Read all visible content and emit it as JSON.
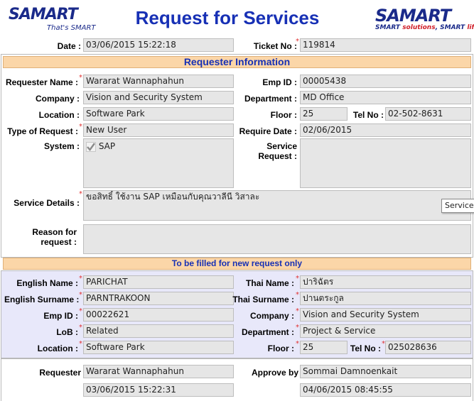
{
  "header": {
    "logo_left": "SAMART",
    "logo_left_tagline": "That's SMART",
    "title": "Request for Services",
    "logo_right": "SAMART",
    "logo_right_tagline_a": "SMART ",
    "logo_right_tagline_b": "solutions",
    "logo_right_tagline_c": ", SMART ",
    "logo_right_tagline_d": "life"
  },
  "top": {
    "date_label": "Date :",
    "date_value": "03/06/2015 15:22:18",
    "ticket_label": "Ticket No :",
    "ticket_value": "119814"
  },
  "requester_section": {
    "title": "Requester Information",
    "requester_name_label": "Requester Name :",
    "requester_name_value": "Wararat Wannaphahun",
    "emp_id_label": "Emp ID :",
    "emp_id_value": "00005438",
    "company_label": "Company :",
    "company_value": "Vision and Security System",
    "department_label": "Department :",
    "department_value": "MD Office",
    "location_label": "Location :",
    "location_value": "Software Park",
    "floor_label": "Floor :",
    "floor_value": "25",
    "tel_label": "Tel No :",
    "tel_value": "02-502-8631",
    "type_label": "Type of Request :",
    "type_value": "New User",
    "require_date_label": "Require Date :",
    "require_date_value": "02/06/2015",
    "system_label": "System :",
    "system_item": "SAP",
    "system_item_checked": true,
    "service_request_label_1": "Service",
    "service_request_label_2": "Request :",
    "service_request_value": "",
    "service_details_label": "Service Details :",
    "service_details_value": "ขอสิทธิ์ ใช้งาน SAP เหมือนกับคุณวาลีนี วิสาละ",
    "reason_label_1": "Reason for",
    "reason_label_2": "request :",
    "reason_value": "",
    "tooltip": "Service"
  },
  "new_request_section": {
    "title": "To be filled for new request only",
    "english_name_label": "English Name :",
    "english_name_value": "PARICHAT",
    "thai_name_label": "Thai Name :",
    "thai_name_value": "ปาริฉัตร",
    "english_surname_label": "English Surname :",
    "english_surname_value": "PARNTRAKOON",
    "thai_surname_label": "Thai Surname :",
    "thai_surname_value": "ปานตระกูล",
    "emp_id_label": "Emp ID :",
    "emp_id_value": "00022621",
    "company_label": "Company :",
    "company_value": "Vision and Security System",
    "lob_label": "LoB :",
    "lob_value": "Related",
    "department_label": "Department :",
    "department_value": "Project & Service",
    "location_label": "Location :",
    "location_value": "Software Park",
    "floor_label": "Floor :",
    "floor_value": "25",
    "tel_label": "Tel No :",
    "tel_value": "025028636"
  },
  "approval": {
    "requester_label": "Requester",
    "requester_value": "Wararat Wannaphahun",
    "requester_date": "03/06/2015 15:22:31",
    "approve_label": "Approve by",
    "approve_value": "Sommai Damnoenkait",
    "approve_date": "04/06/2015 08:45:55"
  },
  "colors": {
    "title_blue": "#1730b5",
    "section_orange": "#fbd6a8",
    "panel_lavender": "#e8e8fa",
    "required_red": "#e03030"
  }
}
